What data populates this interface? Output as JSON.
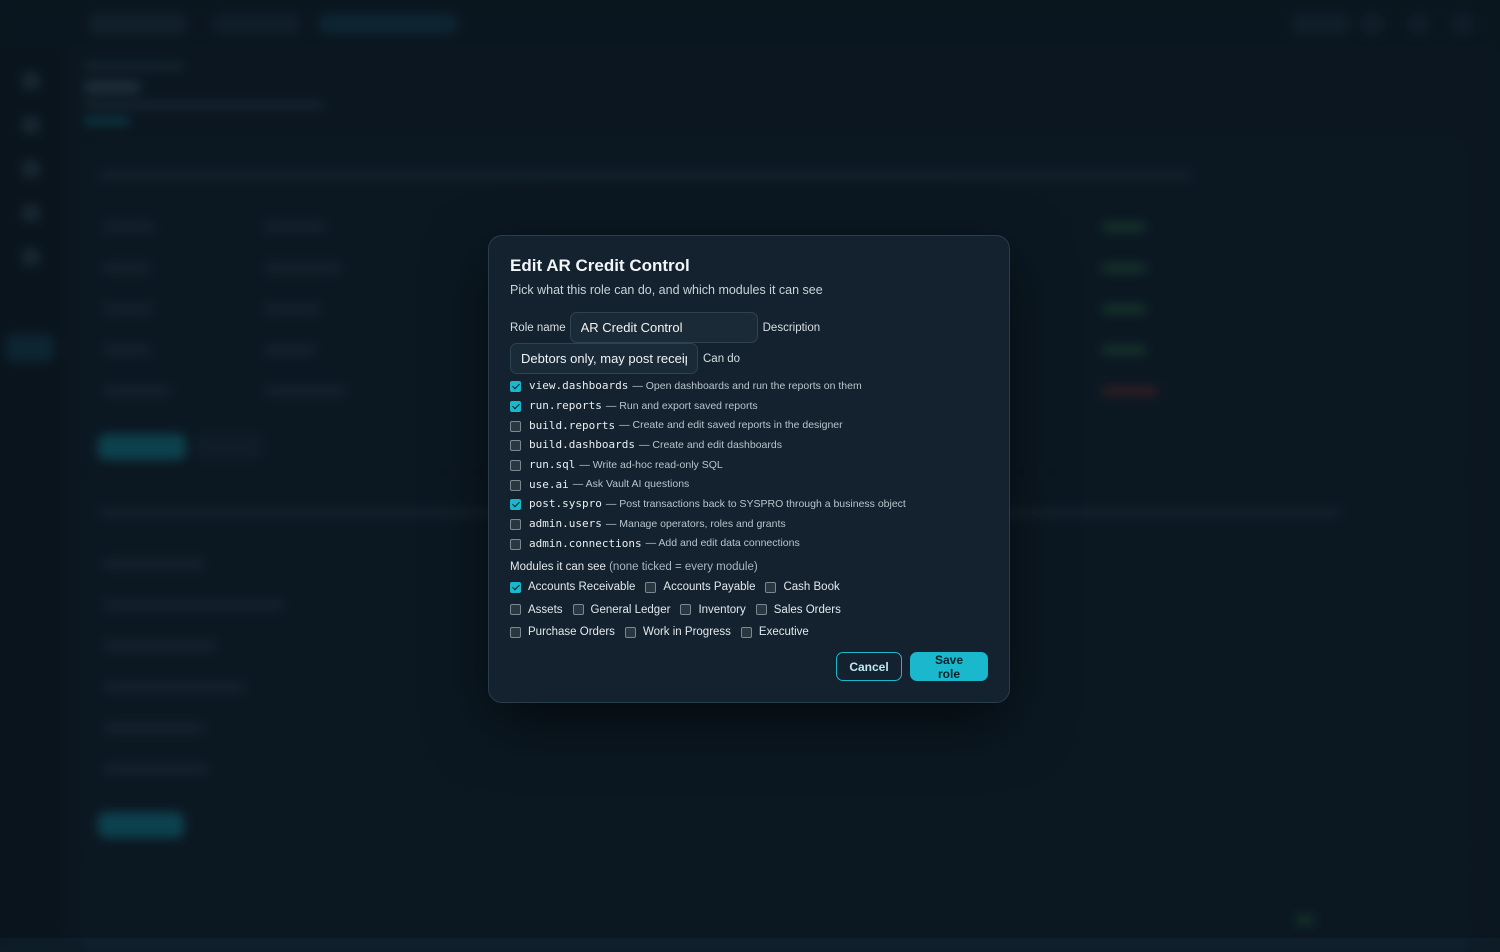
{
  "modal": {
    "title": "Edit AR Credit Control",
    "subtitle": "Pick what this role can do, and which modules it can see",
    "role_name_label": "Role name",
    "role_name_value": "AR Credit Control",
    "description_label": "Description",
    "description_value": "Debtors only, may post receip",
    "can_do_label": "Can do",
    "permissions": [
      {
        "code": "view.dashboards",
        "desc": "— Open dashboards and run the reports on them",
        "checked": true
      },
      {
        "code": "run.reports",
        "desc": "— Run and export saved reports",
        "checked": true
      },
      {
        "code": "build.reports",
        "desc": "— Create and edit saved reports in the designer",
        "checked": false
      },
      {
        "code": "build.dashboards",
        "desc": "— Create and edit dashboards",
        "checked": false
      },
      {
        "code": "run.sql",
        "desc": "— Write ad-hoc read-only SQL",
        "checked": false
      },
      {
        "code": "use.ai",
        "desc": "— Ask Vault AI questions",
        "checked": false
      },
      {
        "code": "post.syspro",
        "desc": "— Post transactions back to SYSPRO through a business object",
        "checked": true
      },
      {
        "code": "admin.users",
        "desc": "— Manage operators, roles and grants",
        "checked": false
      },
      {
        "code": "admin.connections",
        "desc": "— Add and edit data connections",
        "checked": false
      }
    ],
    "modules_label": "Modules it can see",
    "modules_hint": "(none ticked = every module)",
    "modules": [
      {
        "label": "Accounts Receivable",
        "checked": true
      },
      {
        "label": "Accounts Payable",
        "checked": false
      },
      {
        "label": "Cash Book",
        "checked": false
      },
      {
        "label": "Assets",
        "checked": false
      },
      {
        "label": "General Ledger",
        "checked": false
      },
      {
        "label": "Inventory",
        "checked": false
      },
      {
        "label": "Sales Orders",
        "checked": false
      },
      {
        "label": "Purchase Orders",
        "checked": false
      },
      {
        "label": "Work in Progress",
        "checked": false
      },
      {
        "label": "Executive",
        "checked": false
      }
    ],
    "cancel_label": "Cancel",
    "save_label": "Save role"
  },
  "colors": {
    "accent": "#19b8cc",
    "modal_bg": "#13222e",
    "page_bg": "#0d1c27"
  }
}
